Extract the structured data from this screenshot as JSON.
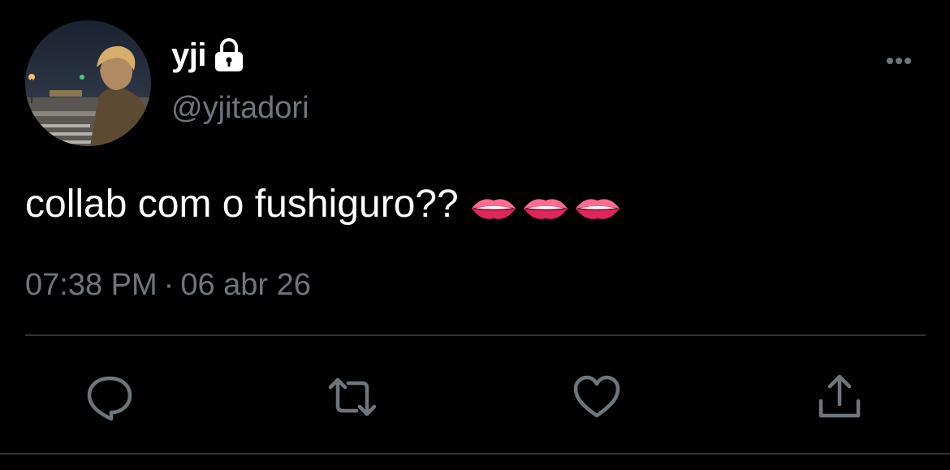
{
  "user": {
    "display_name": "yji",
    "handle": "@yjitadori",
    "avatar_icon": "profile-photo",
    "protected_icon": "lock-icon"
  },
  "tweet": {
    "text": "collab com o fushiguro??",
    "emoji": [
      "lips",
      "lips",
      "lips"
    ],
    "time": "07:38 PM",
    "separator": "·",
    "date": "06 abr 26"
  },
  "actions": {
    "reply_icon": "reply-icon",
    "retweet_icon": "retweet-icon",
    "like_icon": "heart-icon",
    "share_icon": "share-icon",
    "more_icon": "more-icon"
  },
  "colors": {
    "background": "#000000",
    "primary_text": "#ffffff",
    "secondary_text": "#6e767d",
    "divider": "#2f3336",
    "lips": "#e0245e"
  }
}
